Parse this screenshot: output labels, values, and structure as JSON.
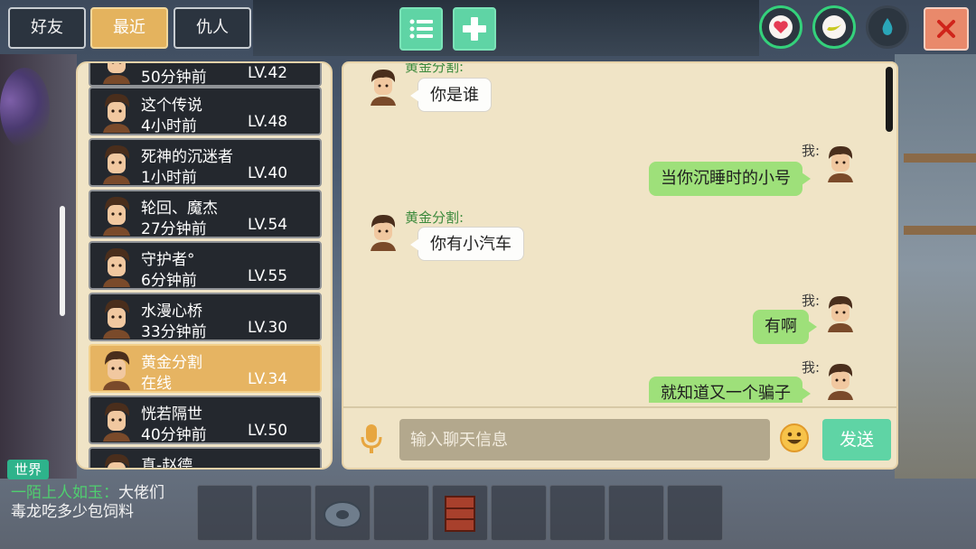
{
  "tabs": [
    {
      "label": "好友",
      "active": false
    },
    {
      "label": "最近",
      "active": true
    },
    {
      "label": "仇人",
      "active": false
    }
  ],
  "toolbar_icons": [
    "list-icon",
    "plus-icon"
  ],
  "status_icons": [
    "heart-icon",
    "hunger-icon",
    "water-drop-icon"
  ],
  "colors": {
    "accent_green": "#5fd4a5",
    "selected_row": "#e6b462",
    "my_bubble": "#9ee07a",
    "panel_bg": "#f0e4c6",
    "close_button": "#e9896b"
  },
  "friends": {
    "partial_top": {
      "time": "50分钟前",
      "level": "LV.42"
    },
    "items": [
      {
        "name": "这个传说",
        "time": "4小时前",
        "level": "LV.48",
        "selected": false
      },
      {
        "name": "死神的沉迷者",
        "time": "1小时前",
        "level": "LV.40",
        "selected": false
      },
      {
        "name": "轮回、魔杰",
        "time": "27分钟前",
        "level": "LV.54",
        "selected": false
      },
      {
        "name": "守护者°",
        "time": "6分钟前",
        "level": "LV.55",
        "selected": false
      },
      {
        "name": "水漫心桥",
        "time": "33分钟前",
        "level": "LV.30",
        "selected": false
      },
      {
        "name": "黄金分割",
        "time": "在线",
        "level": "LV.34",
        "selected": true
      },
      {
        "name": "恍若隔世",
        "time": "40分钟前",
        "level": "LV.50",
        "selected": false
      }
    ],
    "partial_bottom": {
      "name": "真-赵德"
    }
  },
  "chat": {
    "messages": [
      {
        "from": "other",
        "sender": "黄金分割:",
        "text": "你是谁"
      },
      {
        "from": "me",
        "sender": "我:",
        "text": "当你沉睡时的小号"
      },
      {
        "from": "other",
        "sender": "黄金分割:",
        "text": "你有小汽车"
      },
      {
        "from": "me",
        "sender": "我:",
        "text": "有啊"
      },
      {
        "from": "me",
        "sender": "我:",
        "text": "就知道又一个骗子"
      }
    ],
    "input_placeholder": "输入聊天信息",
    "send_label": "发送"
  },
  "world": {
    "badge": "世界",
    "author": "一陌上人如玉",
    "separator": "：",
    "text1": "大佬们",
    "text2": "毒龙吃多少包饲料"
  }
}
